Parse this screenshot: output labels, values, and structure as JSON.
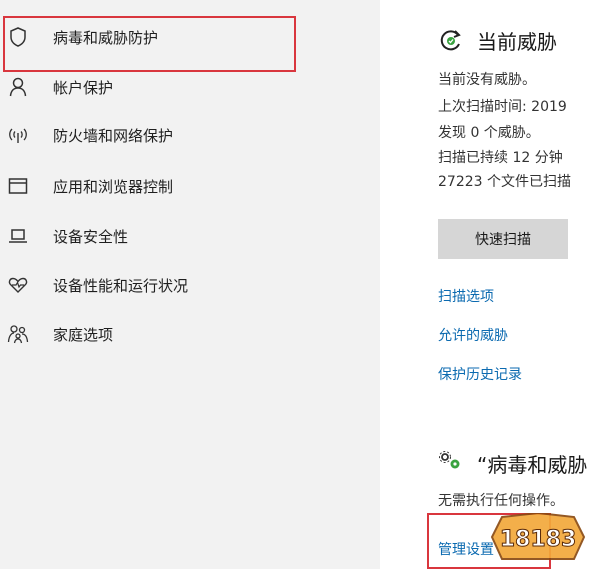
{
  "sidebar": {
    "items": [
      {
        "label": "病毒和威胁防护",
        "icon": "shield-icon"
      },
      {
        "label": "帐户保护",
        "icon": "person-icon"
      },
      {
        "label": "防火墙和网络保护",
        "icon": "wireless-icon"
      },
      {
        "label": "应用和浏览器控制",
        "icon": "app-window-icon"
      },
      {
        "label": "设备安全性",
        "icon": "laptop-icon"
      },
      {
        "label": "设备性能和运行状况",
        "icon": "heart-icon"
      },
      {
        "label": "家庭选项",
        "icon": "family-icon"
      }
    ],
    "highlight_color": "#d9363e"
  },
  "threats": {
    "title": "当前威胁",
    "icon": "scan-refresh-icon",
    "lines": [
      "当前没有威胁。",
      "上次扫描时间: 2019",
      "发现 0 个威胁。",
      "扫描已持续 12 分钟",
      "27223 个文件已扫描"
    ],
    "quick_scan_label": "快速扫描",
    "links": [
      "扫描选项",
      "允许的威胁",
      "保护历史记录"
    ]
  },
  "settings": {
    "title": "“病毒和威胁",
    "icon": "gears-icon",
    "status": "无需执行任何操作。",
    "manage_label": "管理设置"
  },
  "watermark": {
    "text": "18183"
  },
  "colors": {
    "link": "#0b6ab0",
    "accent_green": "#3aa340",
    "button_bg": "#d6d6d6"
  }
}
